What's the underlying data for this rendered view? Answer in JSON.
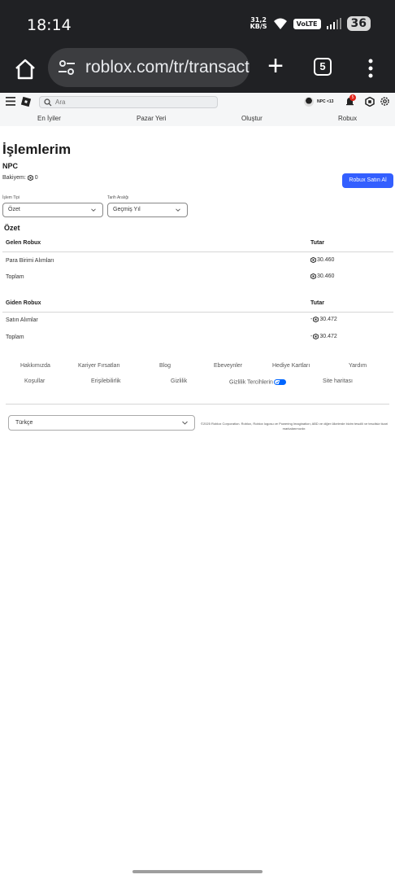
{
  "status_bar": {
    "time": "18:14",
    "net_speed_value": "31,2",
    "net_speed_unit": "KB/S",
    "volte": "VoLTE",
    "battery": "36"
  },
  "browser": {
    "url": "roblox.com/tr/transact",
    "tab_count": "5"
  },
  "site_header": {
    "search_placeholder": "Ara",
    "username": "NPC",
    "username_suffix": "<13",
    "notification_count": "5"
  },
  "nav": {
    "items": [
      "En İyiler",
      "Pazar Yeri",
      "Oluştur",
      "Robux"
    ]
  },
  "page": {
    "title": "İşlemlerim",
    "owner": "NPC",
    "balance_label": "Bakiyem:",
    "balance_value": "0",
    "buy_button": "Robux Satın Al"
  },
  "filters": {
    "type_label": "İşlem Tipi",
    "type_value": "Özet",
    "date_label": "Tarih Aralığı",
    "date_value": "Geçmiş Yıl"
  },
  "summary": {
    "title": "Özet",
    "incoming": {
      "header": "Gelen Robux",
      "amount_header": "Tutar",
      "rows": [
        {
          "label": "Para Birimi Alımları",
          "value": "30.460"
        },
        {
          "label": "Toplam",
          "value": "30.460"
        }
      ]
    },
    "outgoing": {
      "header": "Giden Robux",
      "amount_header": "Tutar",
      "rows": [
        {
          "label": "Satın Alımlar",
          "prefix": "-",
          "value": "30.472"
        },
        {
          "label": "Toplam",
          "prefix": "-",
          "value": "30.472"
        }
      ]
    }
  },
  "footer": {
    "links_row1": [
      "Hakkımızda",
      "Kariyer Fırsatları",
      "Blog",
      "Ebeveynler",
      "Hediye Kartları",
      "Yardım"
    ],
    "links_row2": [
      "Koşullar",
      "Erişilebilirlik",
      "Gizlilik",
      "Gizlilik Tercihlerin",
      "Site haritası"
    ],
    "language": "Türkçe",
    "copyright": "©2025 Roblox Corporation. Roblox, Roblox logosu ve Powering Imagination; ABD ve diğer ülkelerde bizim tescilli ve tescilsiz ticari markalarımızdır."
  },
  "colors": {
    "accent": "#335fff",
    "chrome": "#202124",
    "notification": "#e2231a"
  }
}
